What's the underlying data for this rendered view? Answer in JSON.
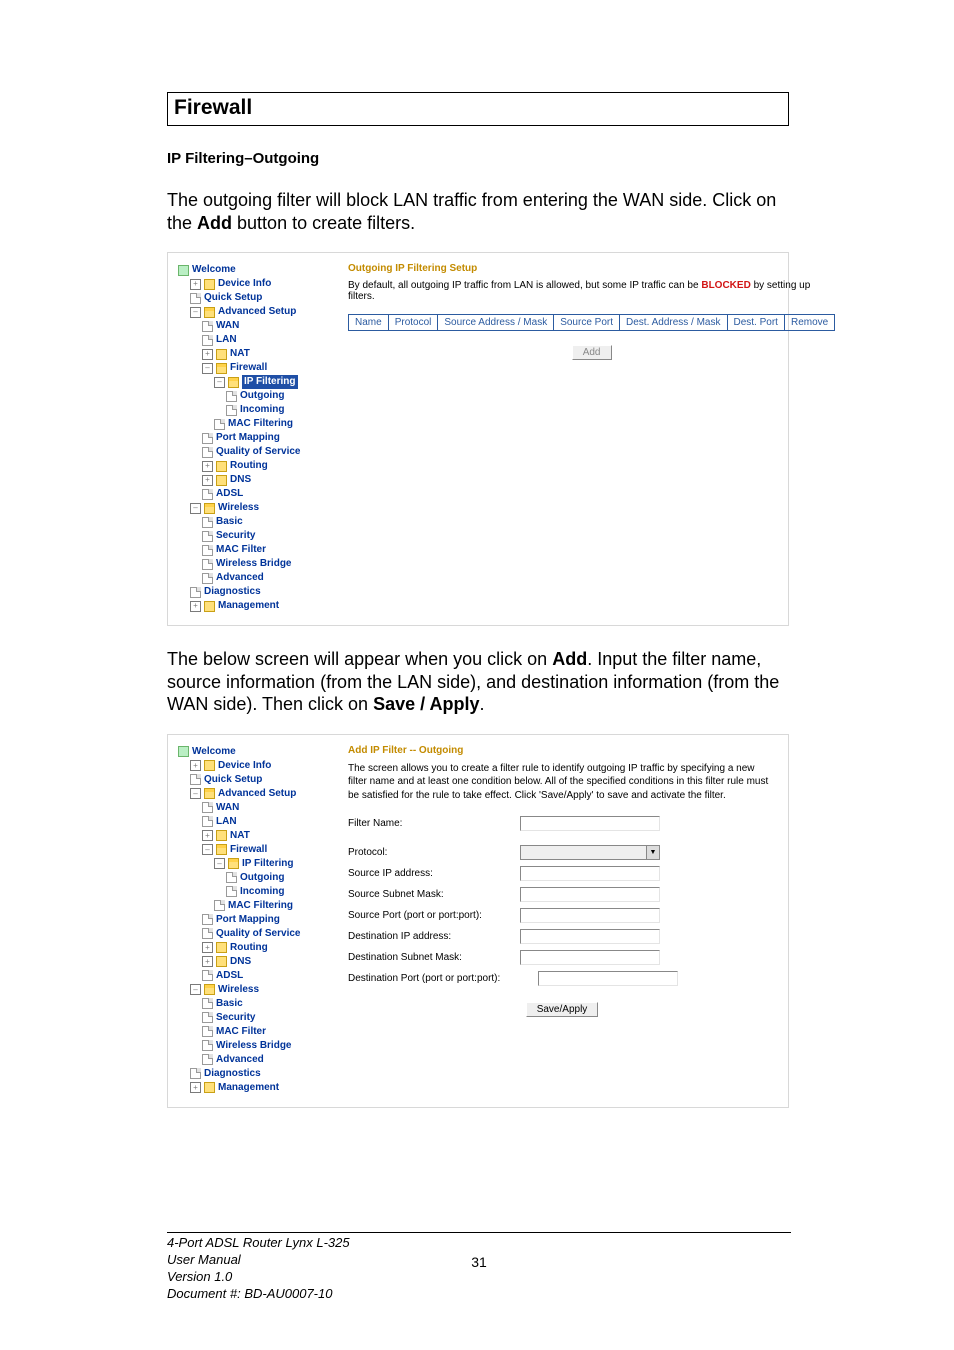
{
  "section_title": "Firewall",
  "subheading": "IP Filtering–Outgoing",
  "para1_a": "The outgoing filter will block LAN traffic from entering the WAN side.  Click on the ",
  "para1_b": "Add",
  "para1_c": " button to create filters.",
  "para2_a": "The below screen will appear when you click on ",
  "para2_b": "Add",
  "para2_c": ".  Input the filter name, source information (from the LAN side), and destination information (from the WAN side). Then click on ",
  "para2_d": "Save / Apply",
  "para2_e": ".",
  "tree": {
    "welcome": "Welcome",
    "device_info": "Device Info",
    "quick_setup": "Quick Setup",
    "advanced_setup": "Advanced Setup",
    "wan": "WAN",
    "lan": "LAN",
    "nat": "NAT",
    "firewall": "Firewall",
    "ip_filtering": "IP Filtering",
    "outgoing": "Outgoing",
    "incoming": "Incoming",
    "mac_filtering": "MAC Filtering",
    "port_mapping": "Port Mapping",
    "qos": "Quality of Service",
    "routing": "Routing",
    "dns": "DNS",
    "adsl": "ADSL",
    "wireless": "Wireless",
    "basic": "Basic",
    "security": "Security",
    "mac_filter": "MAC Filter",
    "wireless_bridge": "Wireless Bridge",
    "advanced": "Advanced",
    "diagnostics": "Diagnostics",
    "management": "Management"
  },
  "shot1": {
    "title": "Outgoing IP Filtering Setup",
    "desc_a": "By default, all outgoing IP traffic from LAN is allowed, but some IP traffic can be ",
    "desc_block": "BLOCKED",
    "desc_b": " by setting up filters.",
    "cols": [
      "Name",
      "Protocol",
      "Source Address / Mask",
      "Source Port",
      "Dest. Address / Mask",
      "Dest. Port",
      "Remove"
    ],
    "add_btn": "Add"
  },
  "shot2": {
    "title": "Add IP Filter -- Outgoing",
    "instr": "The screen allows you to create a filter rule to identify outgoing IP traffic by specifying a new filter name and at least one condition below. All of the specified conditions in this filter rule must be satisfied for the rule to take effect. Click 'Save/Apply' to save and activate the filter.",
    "labels": {
      "filter_name": "Filter Name:",
      "protocol": "Protocol:",
      "src_ip": "Source IP address:",
      "src_mask": "Source Subnet Mask:",
      "src_port": "Source Port (port or port:port):",
      "dst_ip": "Destination IP address:",
      "dst_mask": "Destination Subnet Mask:",
      "dst_port": "Destination Port (port or port:port):"
    },
    "save_btn": "Save/Apply"
  },
  "footer": {
    "line1": "4-Port ADSL Router Lynx L-325",
    "line2": "User Manual",
    "line3": "Version 1.0",
    "line4": "Document #:  BD-AU0007-10",
    "page": "31"
  }
}
